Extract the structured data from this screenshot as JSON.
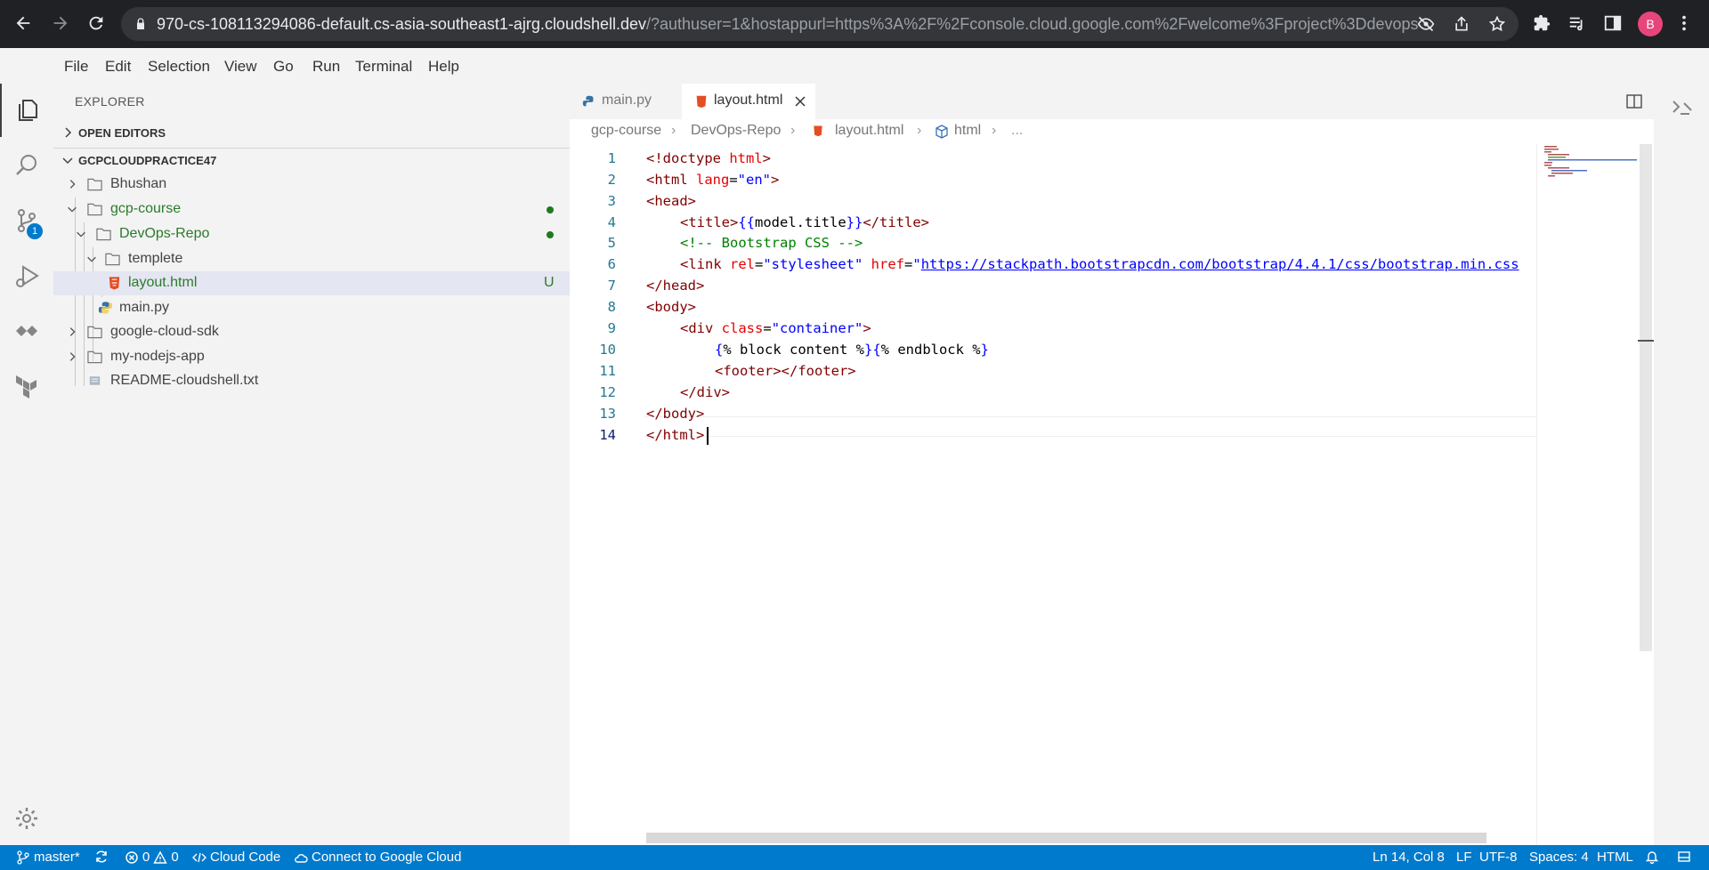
{
  "browser": {
    "url_host": "970-cs-108113294086-default.cs-asia-southeast1-ajrg.cloudshell.dev",
    "url_rest": "/?authuser=1&hostappurl=https%3A%2F%2Fconsole.cloud.google.com%2Fwelcome%3Fproject%3Ddevops-pr...",
    "profile_initial": "B"
  },
  "menu": [
    "File",
    "Edit",
    "Selection",
    "View",
    "Go",
    "Run",
    "Terminal",
    "Help"
  ],
  "activity": {
    "scm_badge": "1"
  },
  "explorer": {
    "title": "EXPLORER",
    "open_editors": "OPEN EDITORS",
    "workspace": "GCPCLOUDPRACTICE47",
    "tree": [
      {
        "label": "Bhushan",
        "kind": "folder",
        "state": "collapsed"
      },
      {
        "label": "gcp-course",
        "kind": "folder",
        "state": "expanded",
        "modified": true
      },
      {
        "label": "DevOps-Repo",
        "kind": "folder",
        "state": "expanded",
        "modified": true
      },
      {
        "label": "templete",
        "kind": "folder",
        "state": "expanded"
      },
      {
        "label": "layout.html",
        "kind": "html-file",
        "status": "U",
        "selected": true
      },
      {
        "label": "main.py",
        "kind": "python-file"
      },
      {
        "label": "google-cloud-sdk",
        "kind": "folder",
        "state": "collapsed"
      },
      {
        "label": "my-nodejs-app",
        "kind": "folder",
        "state": "collapsed"
      },
      {
        "label": "README-cloudshell.txt",
        "kind": "text-file"
      }
    ]
  },
  "editor": {
    "tabs": [
      {
        "label": "main.py",
        "active": false
      },
      {
        "label": "layout.html",
        "active": true
      }
    ],
    "breadcrumb": [
      "gcp-course",
      "DevOps-Repo",
      "layout.html",
      "html",
      "..."
    ],
    "line_numbers": [
      "1",
      "2",
      "3",
      "4",
      "5",
      "6",
      "7",
      "8",
      "9",
      "10",
      "11",
      "12",
      "13",
      "14"
    ],
    "code": {
      "l1_a": "<!doctype ",
      "l1_b": "html",
      "l1_c": ">",
      "l2_a": "<html ",
      "l2_b": "lang",
      "l2_c": "=",
      "l2_d": "\"en\"",
      "l2_e": ">",
      "l3": "<head>",
      "l4_a": "<title>",
      "l4_b": "{{",
      "l4_c": "model.title",
      "l4_d": "}}",
      "l4_e": "</title>",
      "l5": "<!-- Bootstrap CSS -->",
      "l6_a": "<link ",
      "l6_b": "rel",
      "l6_c": "=",
      "l6_d": "\"stylesheet\"",
      "l6_e": " href",
      "l6_f": "=",
      "l6_g": "\"",
      "l6_h": "https://stackpath.bootstrapcdn.com/bootstrap/4.4.1/css/bootstrap.min.css",
      "l7": "</head>",
      "l8": "<body>",
      "l9_a": "<div ",
      "l9_b": "class",
      "l9_c": "=",
      "l9_d": "\"container\"",
      "l9_e": ">",
      "l10_a": "{",
      "l10_b": "% block content %",
      "l10_c": "}{",
      "l10_d": "% endblock %",
      "l10_e": "}",
      "l11": "<footer></footer>",
      "l12": "</div>",
      "l13": "</body>",
      "l14": "</html>"
    }
  },
  "status": {
    "branch": "master*",
    "errors": "0",
    "warnings": "0",
    "cloud_code": "Cloud Code",
    "connect": "Connect to Google Cloud",
    "position": "Ln 14, Col 8",
    "eol": "LF",
    "encoding": "UTF-8",
    "indent": "Spaces: 4",
    "language": "HTML"
  },
  "colors": {
    "statusbar": "#007acc",
    "chrome": "#202124",
    "sidebar": "#f3f3f3",
    "modified": "#2c7a2c"
  }
}
